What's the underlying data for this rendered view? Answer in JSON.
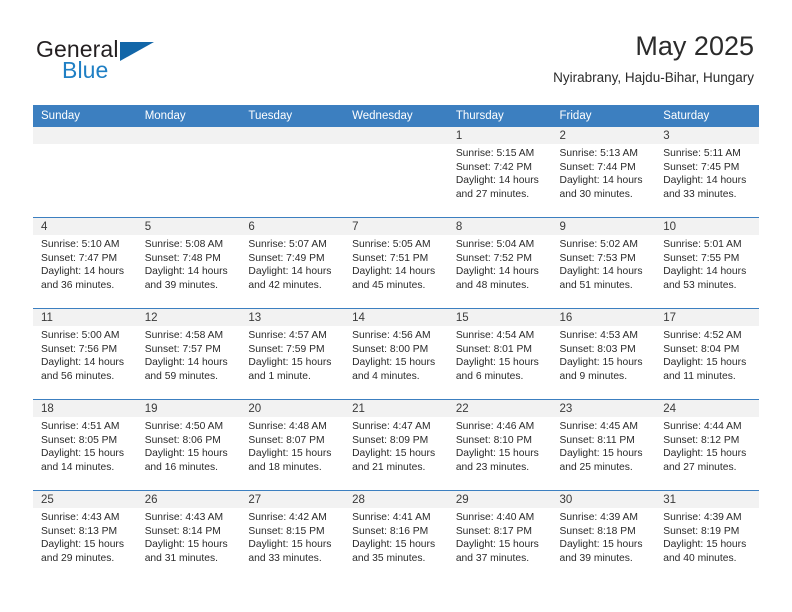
{
  "brand": {
    "name_part1": "General",
    "name_part2": "Blue",
    "accent_color": "#1f7fc4",
    "flag_icon": "triangle-flag-icon"
  },
  "header": {
    "title": "May 2025",
    "subtitle": "Nyirabrany, Hajdu-Bihar, Hungary"
  },
  "calendar": {
    "header_bg": "#3c7fc0",
    "daynum_bg": "#f2f2f2",
    "weekday_headers": [
      "Sunday",
      "Monday",
      "Tuesday",
      "Wednesday",
      "Thursday",
      "Friday",
      "Saturday"
    ],
    "weeks": [
      [
        {
          "day": "",
          "sunrise": "",
          "sunset": "",
          "daylight_line1": "",
          "daylight_line2": ""
        },
        {
          "day": "",
          "sunrise": "",
          "sunset": "",
          "daylight_line1": "",
          "daylight_line2": ""
        },
        {
          "day": "",
          "sunrise": "",
          "sunset": "",
          "daylight_line1": "",
          "daylight_line2": ""
        },
        {
          "day": "",
          "sunrise": "",
          "sunset": "",
          "daylight_line1": "",
          "daylight_line2": ""
        },
        {
          "day": "1",
          "sunrise": "Sunrise: 5:15 AM",
          "sunset": "Sunset: 7:42 PM",
          "daylight_line1": "Daylight: 14 hours",
          "daylight_line2": "and 27 minutes."
        },
        {
          "day": "2",
          "sunrise": "Sunrise: 5:13 AM",
          "sunset": "Sunset: 7:44 PM",
          "daylight_line1": "Daylight: 14 hours",
          "daylight_line2": "and 30 minutes."
        },
        {
          "day": "3",
          "sunrise": "Sunrise: 5:11 AM",
          "sunset": "Sunset: 7:45 PM",
          "daylight_line1": "Daylight: 14 hours",
          "daylight_line2": "and 33 minutes."
        }
      ],
      [
        {
          "day": "4",
          "sunrise": "Sunrise: 5:10 AM",
          "sunset": "Sunset: 7:47 PM",
          "daylight_line1": "Daylight: 14 hours",
          "daylight_line2": "and 36 minutes."
        },
        {
          "day": "5",
          "sunrise": "Sunrise: 5:08 AM",
          "sunset": "Sunset: 7:48 PM",
          "daylight_line1": "Daylight: 14 hours",
          "daylight_line2": "and 39 minutes."
        },
        {
          "day": "6",
          "sunrise": "Sunrise: 5:07 AM",
          "sunset": "Sunset: 7:49 PM",
          "daylight_line1": "Daylight: 14 hours",
          "daylight_line2": "and 42 minutes."
        },
        {
          "day": "7",
          "sunrise": "Sunrise: 5:05 AM",
          "sunset": "Sunset: 7:51 PM",
          "daylight_line1": "Daylight: 14 hours",
          "daylight_line2": "and 45 minutes."
        },
        {
          "day": "8",
          "sunrise": "Sunrise: 5:04 AM",
          "sunset": "Sunset: 7:52 PM",
          "daylight_line1": "Daylight: 14 hours",
          "daylight_line2": "and 48 minutes."
        },
        {
          "day": "9",
          "sunrise": "Sunrise: 5:02 AM",
          "sunset": "Sunset: 7:53 PM",
          "daylight_line1": "Daylight: 14 hours",
          "daylight_line2": "and 51 minutes."
        },
        {
          "day": "10",
          "sunrise": "Sunrise: 5:01 AM",
          "sunset": "Sunset: 7:55 PM",
          "daylight_line1": "Daylight: 14 hours",
          "daylight_line2": "and 53 minutes."
        }
      ],
      [
        {
          "day": "11",
          "sunrise": "Sunrise: 5:00 AM",
          "sunset": "Sunset: 7:56 PM",
          "daylight_line1": "Daylight: 14 hours",
          "daylight_line2": "and 56 minutes."
        },
        {
          "day": "12",
          "sunrise": "Sunrise: 4:58 AM",
          "sunset": "Sunset: 7:57 PM",
          "daylight_line1": "Daylight: 14 hours",
          "daylight_line2": "and 59 minutes."
        },
        {
          "day": "13",
          "sunrise": "Sunrise: 4:57 AM",
          "sunset": "Sunset: 7:59 PM",
          "daylight_line1": "Daylight: 15 hours",
          "daylight_line2": "and 1 minute."
        },
        {
          "day": "14",
          "sunrise": "Sunrise: 4:56 AM",
          "sunset": "Sunset: 8:00 PM",
          "daylight_line1": "Daylight: 15 hours",
          "daylight_line2": "and 4 minutes."
        },
        {
          "day": "15",
          "sunrise": "Sunrise: 4:54 AM",
          "sunset": "Sunset: 8:01 PM",
          "daylight_line1": "Daylight: 15 hours",
          "daylight_line2": "and 6 minutes."
        },
        {
          "day": "16",
          "sunrise": "Sunrise: 4:53 AM",
          "sunset": "Sunset: 8:03 PM",
          "daylight_line1": "Daylight: 15 hours",
          "daylight_line2": "and 9 minutes."
        },
        {
          "day": "17",
          "sunrise": "Sunrise: 4:52 AM",
          "sunset": "Sunset: 8:04 PM",
          "daylight_line1": "Daylight: 15 hours",
          "daylight_line2": "and 11 minutes."
        }
      ],
      [
        {
          "day": "18",
          "sunrise": "Sunrise: 4:51 AM",
          "sunset": "Sunset: 8:05 PM",
          "daylight_line1": "Daylight: 15 hours",
          "daylight_line2": "and 14 minutes."
        },
        {
          "day": "19",
          "sunrise": "Sunrise: 4:50 AM",
          "sunset": "Sunset: 8:06 PM",
          "daylight_line1": "Daylight: 15 hours",
          "daylight_line2": "and 16 minutes."
        },
        {
          "day": "20",
          "sunrise": "Sunrise: 4:48 AM",
          "sunset": "Sunset: 8:07 PM",
          "daylight_line1": "Daylight: 15 hours",
          "daylight_line2": "and 18 minutes."
        },
        {
          "day": "21",
          "sunrise": "Sunrise: 4:47 AM",
          "sunset": "Sunset: 8:09 PM",
          "daylight_line1": "Daylight: 15 hours",
          "daylight_line2": "and 21 minutes."
        },
        {
          "day": "22",
          "sunrise": "Sunrise: 4:46 AM",
          "sunset": "Sunset: 8:10 PM",
          "daylight_line1": "Daylight: 15 hours",
          "daylight_line2": "and 23 minutes."
        },
        {
          "day": "23",
          "sunrise": "Sunrise: 4:45 AM",
          "sunset": "Sunset: 8:11 PM",
          "daylight_line1": "Daylight: 15 hours",
          "daylight_line2": "and 25 minutes."
        },
        {
          "day": "24",
          "sunrise": "Sunrise: 4:44 AM",
          "sunset": "Sunset: 8:12 PM",
          "daylight_line1": "Daylight: 15 hours",
          "daylight_line2": "and 27 minutes."
        }
      ],
      [
        {
          "day": "25",
          "sunrise": "Sunrise: 4:43 AM",
          "sunset": "Sunset: 8:13 PM",
          "daylight_line1": "Daylight: 15 hours",
          "daylight_line2": "and 29 minutes."
        },
        {
          "day": "26",
          "sunrise": "Sunrise: 4:43 AM",
          "sunset": "Sunset: 8:14 PM",
          "daylight_line1": "Daylight: 15 hours",
          "daylight_line2": "and 31 minutes."
        },
        {
          "day": "27",
          "sunrise": "Sunrise: 4:42 AM",
          "sunset": "Sunset: 8:15 PM",
          "daylight_line1": "Daylight: 15 hours",
          "daylight_line2": "and 33 minutes."
        },
        {
          "day": "28",
          "sunrise": "Sunrise: 4:41 AM",
          "sunset": "Sunset: 8:16 PM",
          "daylight_line1": "Daylight: 15 hours",
          "daylight_line2": "and 35 minutes."
        },
        {
          "day": "29",
          "sunrise": "Sunrise: 4:40 AM",
          "sunset": "Sunset: 8:17 PM",
          "daylight_line1": "Daylight: 15 hours",
          "daylight_line2": "and 37 minutes."
        },
        {
          "day": "30",
          "sunrise": "Sunrise: 4:39 AM",
          "sunset": "Sunset: 8:18 PM",
          "daylight_line1": "Daylight: 15 hours",
          "daylight_line2": "and 39 minutes."
        },
        {
          "day": "31",
          "sunrise": "Sunrise: 4:39 AM",
          "sunset": "Sunset: 8:19 PM",
          "daylight_line1": "Daylight: 15 hours",
          "daylight_line2": "and 40 minutes."
        }
      ]
    ]
  }
}
